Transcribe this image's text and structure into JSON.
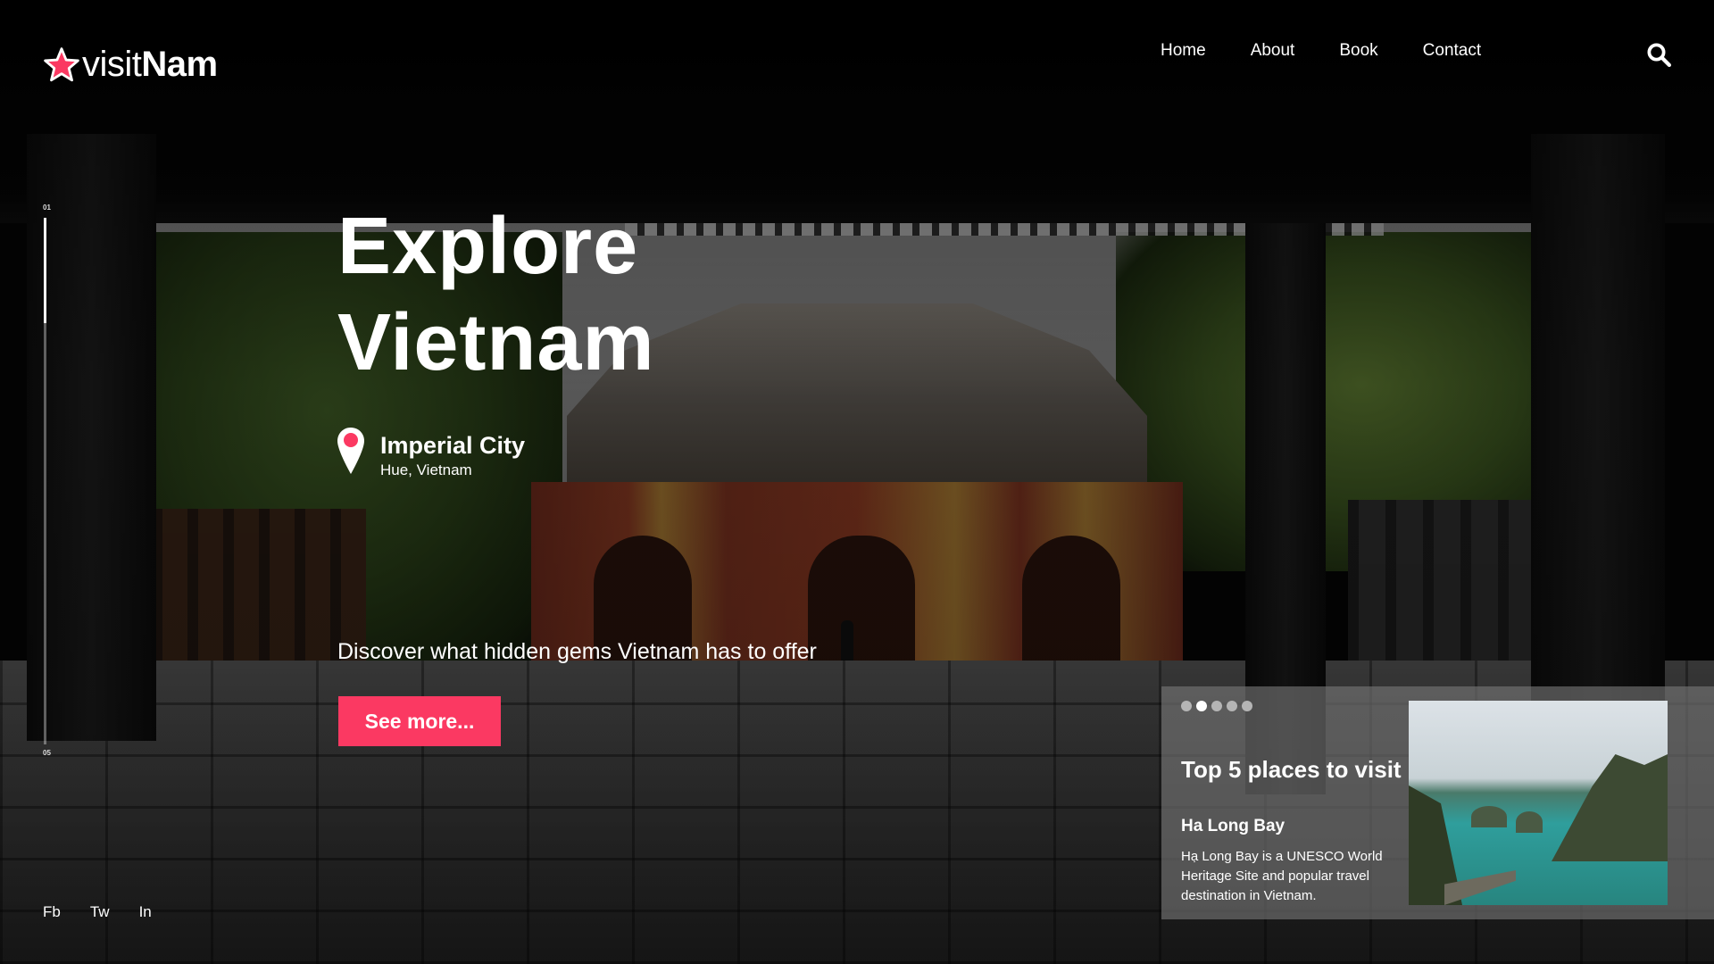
{
  "brand": {
    "light": "visit",
    "bold": "Nam",
    "accent_color": "#fb3962"
  },
  "nav": {
    "items": [
      "Home",
      "About",
      "Book",
      "Contact"
    ]
  },
  "icons": {
    "logo": "star-icon",
    "search": "search-icon",
    "location": "map-pin-icon"
  },
  "slide_indicator": {
    "current": "01",
    "total": "05",
    "progress": 0.2
  },
  "hero": {
    "title_line1": "Explore",
    "title_line2": "Vietnam",
    "location_name": "Imperial City",
    "location_sub": "Hue, Vietnam",
    "tagline": "Discover what hidden gems Vietnam has to offer",
    "cta": "See more..."
  },
  "social": [
    "Fb",
    "Tw",
    "In"
  ],
  "card": {
    "dots_count": 5,
    "active_dot": 1,
    "title": "Top 5 places to visit",
    "place_name": "Ha Long Bay",
    "place_desc": "Hạ Long Bay is a UNESCO World Heritage Site and popular travel destination in Vietnam."
  }
}
